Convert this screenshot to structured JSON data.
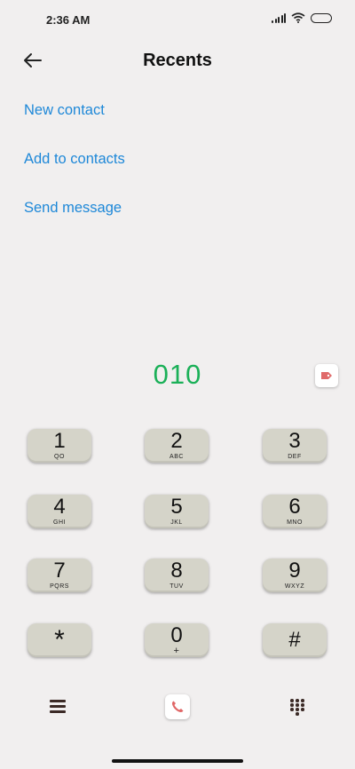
{
  "status_bar": {
    "time": "2:36 AM"
  },
  "header": {
    "title": "Recents"
  },
  "actions": {
    "new_contact": "New contact",
    "add_to_contacts": "Add to contacts",
    "send_message": "Send message"
  },
  "dialed": {
    "number": "010"
  },
  "keypad": {
    "keys": [
      {
        "digit": "1",
        "letters": "QO"
      },
      {
        "digit": "2",
        "letters": "ABC"
      },
      {
        "digit": "3",
        "letters": "DEF"
      },
      {
        "digit": "4",
        "letters": "GHI"
      },
      {
        "digit": "5",
        "letters": "JKL"
      },
      {
        "digit": "6",
        "letters": "MNO"
      },
      {
        "digit": "7",
        "letters": "PQRS"
      },
      {
        "digit": "8",
        "letters": "TUV"
      },
      {
        "digit": "9",
        "letters": "WXYZ"
      },
      {
        "digit": "*",
        "letters": ""
      },
      {
        "digit": "0",
        "letters": "+"
      },
      {
        "digit": "#",
        "letters": ""
      }
    ]
  },
  "icons": {
    "back": "back-arrow-icon",
    "tag": "tag-icon",
    "menu": "menu-icon",
    "call": "phone-icon",
    "dialpad": "dialpad-icon"
  },
  "colors": {
    "accent": "#1e88d8",
    "number": "#1bb058",
    "call": "#e06666",
    "key_bg": "#d5d4c9"
  }
}
